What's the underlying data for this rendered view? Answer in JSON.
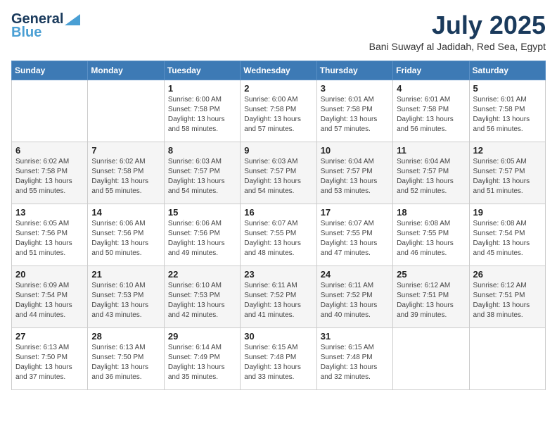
{
  "logo": {
    "line1": "General",
    "line2": "Blue"
  },
  "header": {
    "month": "July 2025",
    "location": "Bani Suwayf al Jadidah, Red Sea, Egypt"
  },
  "weekdays": [
    "Sunday",
    "Monday",
    "Tuesday",
    "Wednesday",
    "Thursday",
    "Friday",
    "Saturday"
  ],
  "weeks": [
    [
      {
        "day": "",
        "info": ""
      },
      {
        "day": "",
        "info": ""
      },
      {
        "day": "1",
        "info": "Sunrise: 6:00 AM\nSunset: 7:58 PM\nDaylight: 13 hours\nand 58 minutes."
      },
      {
        "day": "2",
        "info": "Sunrise: 6:00 AM\nSunset: 7:58 PM\nDaylight: 13 hours\nand 57 minutes."
      },
      {
        "day": "3",
        "info": "Sunrise: 6:01 AM\nSunset: 7:58 PM\nDaylight: 13 hours\nand 57 minutes."
      },
      {
        "day": "4",
        "info": "Sunrise: 6:01 AM\nSunset: 7:58 PM\nDaylight: 13 hours\nand 56 minutes."
      },
      {
        "day": "5",
        "info": "Sunrise: 6:01 AM\nSunset: 7:58 PM\nDaylight: 13 hours\nand 56 minutes."
      }
    ],
    [
      {
        "day": "6",
        "info": "Sunrise: 6:02 AM\nSunset: 7:58 PM\nDaylight: 13 hours\nand 55 minutes."
      },
      {
        "day": "7",
        "info": "Sunrise: 6:02 AM\nSunset: 7:58 PM\nDaylight: 13 hours\nand 55 minutes."
      },
      {
        "day": "8",
        "info": "Sunrise: 6:03 AM\nSunset: 7:57 PM\nDaylight: 13 hours\nand 54 minutes."
      },
      {
        "day": "9",
        "info": "Sunrise: 6:03 AM\nSunset: 7:57 PM\nDaylight: 13 hours\nand 54 minutes."
      },
      {
        "day": "10",
        "info": "Sunrise: 6:04 AM\nSunset: 7:57 PM\nDaylight: 13 hours\nand 53 minutes."
      },
      {
        "day": "11",
        "info": "Sunrise: 6:04 AM\nSunset: 7:57 PM\nDaylight: 13 hours\nand 52 minutes."
      },
      {
        "day": "12",
        "info": "Sunrise: 6:05 AM\nSunset: 7:57 PM\nDaylight: 13 hours\nand 51 minutes."
      }
    ],
    [
      {
        "day": "13",
        "info": "Sunrise: 6:05 AM\nSunset: 7:56 PM\nDaylight: 13 hours\nand 51 minutes."
      },
      {
        "day": "14",
        "info": "Sunrise: 6:06 AM\nSunset: 7:56 PM\nDaylight: 13 hours\nand 50 minutes."
      },
      {
        "day": "15",
        "info": "Sunrise: 6:06 AM\nSunset: 7:56 PM\nDaylight: 13 hours\nand 49 minutes."
      },
      {
        "day": "16",
        "info": "Sunrise: 6:07 AM\nSunset: 7:55 PM\nDaylight: 13 hours\nand 48 minutes."
      },
      {
        "day": "17",
        "info": "Sunrise: 6:07 AM\nSunset: 7:55 PM\nDaylight: 13 hours\nand 47 minutes."
      },
      {
        "day": "18",
        "info": "Sunrise: 6:08 AM\nSunset: 7:55 PM\nDaylight: 13 hours\nand 46 minutes."
      },
      {
        "day": "19",
        "info": "Sunrise: 6:08 AM\nSunset: 7:54 PM\nDaylight: 13 hours\nand 45 minutes."
      }
    ],
    [
      {
        "day": "20",
        "info": "Sunrise: 6:09 AM\nSunset: 7:54 PM\nDaylight: 13 hours\nand 44 minutes."
      },
      {
        "day": "21",
        "info": "Sunrise: 6:10 AM\nSunset: 7:53 PM\nDaylight: 13 hours\nand 43 minutes."
      },
      {
        "day": "22",
        "info": "Sunrise: 6:10 AM\nSunset: 7:53 PM\nDaylight: 13 hours\nand 42 minutes."
      },
      {
        "day": "23",
        "info": "Sunrise: 6:11 AM\nSunset: 7:52 PM\nDaylight: 13 hours\nand 41 minutes."
      },
      {
        "day": "24",
        "info": "Sunrise: 6:11 AM\nSunset: 7:52 PM\nDaylight: 13 hours\nand 40 minutes."
      },
      {
        "day": "25",
        "info": "Sunrise: 6:12 AM\nSunset: 7:51 PM\nDaylight: 13 hours\nand 39 minutes."
      },
      {
        "day": "26",
        "info": "Sunrise: 6:12 AM\nSunset: 7:51 PM\nDaylight: 13 hours\nand 38 minutes."
      }
    ],
    [
      {
        "day": "27",
        "info": "Sunrise: 6:13 AM\nSunset: 7:50 PM\nDaylight: 13 hours\nand 37 minutes."
      },
      {
        "day": "28",
        "info": "Sunrise: 6:13 AM\nSunset: 7:50 PM\nDaylight: 13 hours\nand 36 minutes."
      },
      {
        "day": "29",
        "info": "Sunrise: 6:14 AM\nSunset: 7:49 PM\nDaylight: 13 hours\nand 35 minutes."
      },
      {
        "day": "30",
        "info": "Sunrise: 6:15 AM\nSunset: 7:48 PM\nDaylight: 13 hours\nand 33 minutes."
      },
      {
        "day": "31",
        "info": "Sunrise: 6:15 AM\nSunset: 7:48 PM\nDaylight: 13 hours\nand 32 minutes."
      },
      {
        "day": "",
        "info": ""
      },
      {
        "day": "",
        "info": ""
      }
    ]
  ]
}
